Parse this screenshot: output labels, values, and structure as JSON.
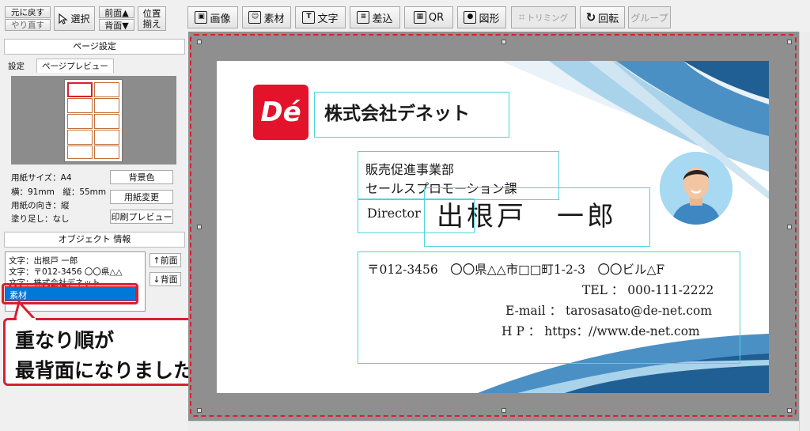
{
  "toolbar_left": {
    "undo": "元に戻す",
    "redo": "やり直す",
    "select": "選択",
    "front": "前面▲",
    "back": "背面▼",
    "align_top": "位置",
    "align_bottom": "揃え"
  },
  "toolbar_main": [
    {
      "label": "画像",
      "icon": "image-icon",
      "enabled": true
    },
    {
      "label": "素材",
      "icon": "material-icon",
      "enabled": true
    },
    {
      "label": "文字",
      "icon": "text-icon",
      "enabled": true
    },
    {
      "label": "差込",
      "icon": "merge-icon",
      "enabled": true
    },
    {
      "label": "QR",
      "icon": "qr-icon",
      "enabled": true
    },
    {
      "label": "図形",
      "icon": "shape-icon",
      "enabled": true
    },
    {
      "label": "トリミング",
      "icon": "crop-icon",
      "enabled": false
    },
    {
      "label": "回転",
      "icon": "rotate-icon",
      "enabled": true
    },
    {
      "label": "グループ",
      "icon": "",
      "enabled": false
    }
  ],
  "page_settings": {
    "title": "ページ設定",
    "tab_settings": "設定",
    "tab_preview": "ページプレビュー",
    "paper_size": "用紙サイズ：A4",
    "dimensions": "横：91mm　縦：55mm",
    "orientation": "用紙の向き：縦",
    "bleed": "塗り足し：なし",
    "btn_bg_color": "背景色",
    "btn_change_paper": "用紙変更",
    "btn_print_preview": "印刷プレビュー"
  },
  "object_info": {
    "title": "オブジェクト 情報",
    "items": [
      "文字：出根戸 一郎",
      "文字：〒012-3456 〇〇県△△",
      "文字：株式会社デネット",
      "素材"
    ],
    "selected_index": 3,
    "btn_front": "↑前面",
    "btn_back": "↓背面"
  },
  "callout": {
    "line1": "重なり順が",
    "line2": "最背面になりました"
  },
  "card": {
    "logo": "Dé",
    "company": "株式会社デネット",
    "department": "販売促進事業部",
    "section": "セールスプロモーション課",
    "title": "Director",
    "name": "出根戸　一郎",
    "address": "〒012-3456　〇〇県△△市□□町1-2-3　〇〇ビル△F",
    "tel": "TEL ： 000-111-2222",
    "email": "E-mail ： tarosasato@de-net.com",
    "web": "H P ： https：//www.de-net.com"
  },
  "colors": {
    "accent_red": "#d8202f",
    "selection_cyan": "#4fd3df",
    "logo_red": "#e3132b",
    "wave_dark": "#1f5f93",
    "wave_mid": "#4a90c4",
    "wave_light": "#a9d3ea"
  }
}
